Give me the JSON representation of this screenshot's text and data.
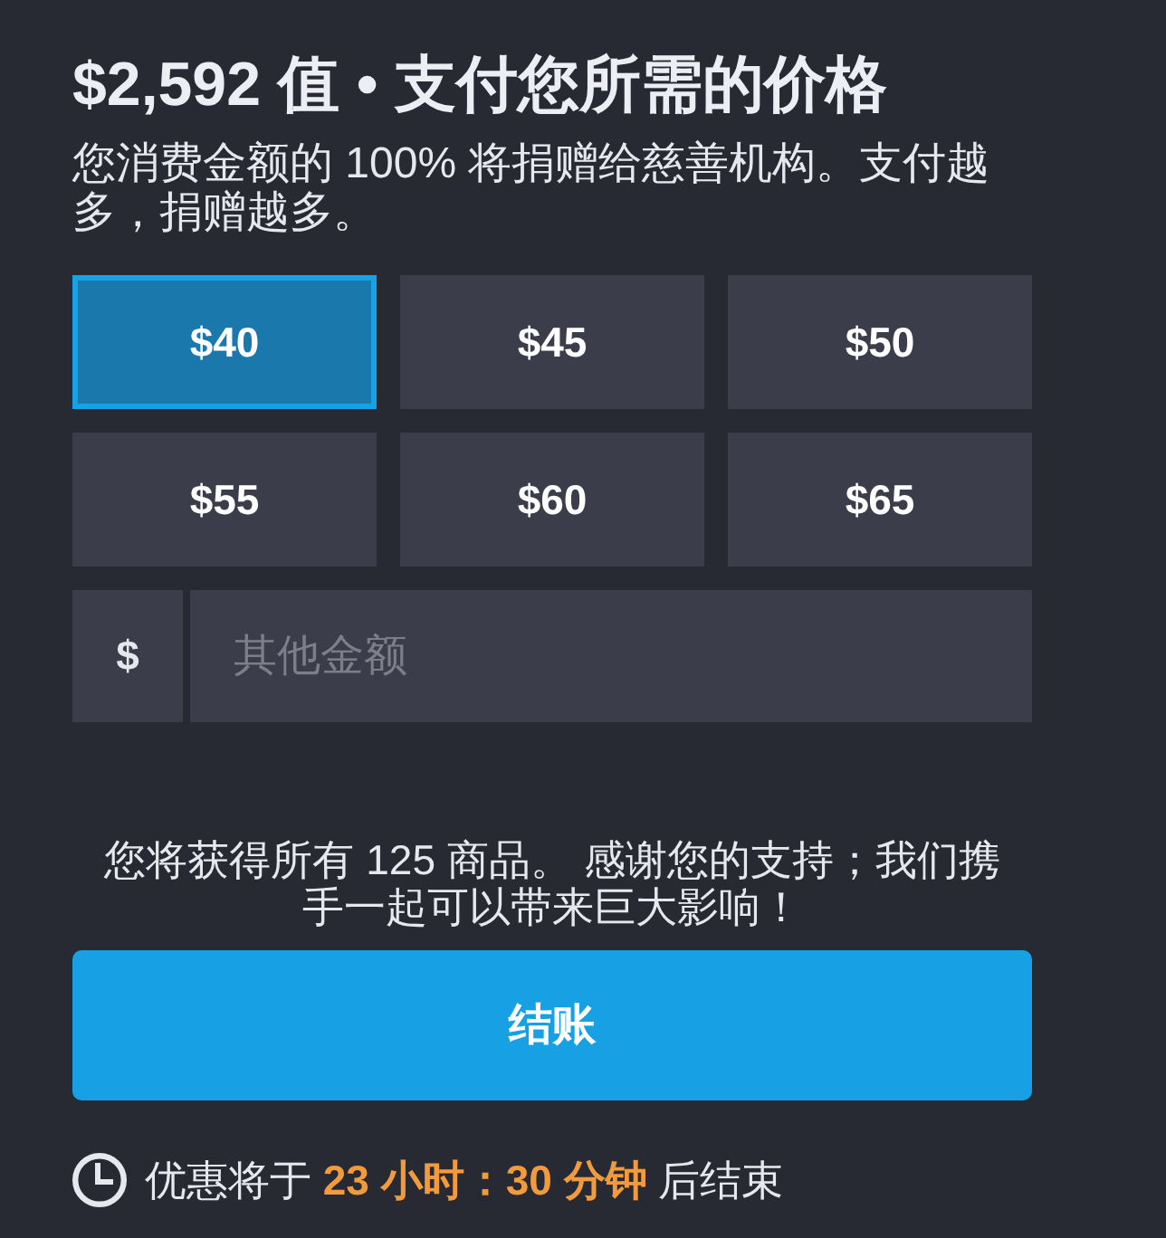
{
  "header": {
    "title": "$2,592 值 • 支付您所需的价格",
    "subtitle": "您消费金额的 100% 将捐赠给慈善机构。支付越多，捐赠越多。"
  },
  "amounts": [
    {
      "label": "$40",
      "selected": true
    },
    {
      "label": "$45",
      "selected": false
    },
    {
      "label": "$50",
      "selected": false
    },
    {
      "label": "$55",
      "selected": false
    },
    {
      "label": "$60",
      "selected": false
    },
    {
      "label": "$65",
      "selected": false
    }
  ],
  "custom_amount": {
    "currency": "$",
    "placeholder": "其他金额"
  },
  "summary": "您将获得所有 125 商品。 感谢您的支持；我们携手一起可以带来巨大影响！",
  "checkout_button": "结账",
  "timer": {
    "text": "优惠将于 **23 小时：30 分钟** 后结束"
  }
}
